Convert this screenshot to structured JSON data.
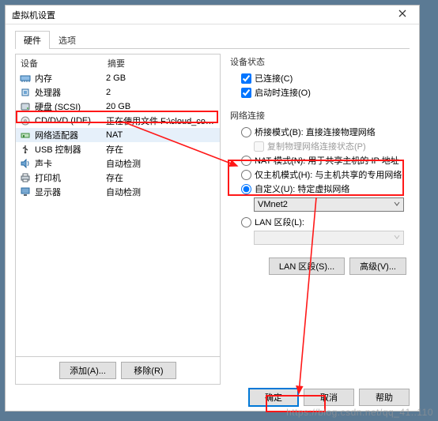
{
  "window": {
    "title": "虚拟机设置"
  },
  "tabs": {
    "hardware": "硬件",
    "options": "选项"
  },
  "columns": {
    "device": "设备",
    "summary": "摘要"
  },
  "devices": [
    {
      "icon": "memory-icon",
      "label": "内存",
      "summary": "2 GB"
    },
    {
      "icon": "cpu-icon",
      "label": "处理器",
      "summary": "2"
    },
    {
      "icon": "disk-icon",
      "label": "硬盘 (SCSI)",
      "summary": "20 GB"
    },
    {
      "icon": "cd-icon",
      "label": "CD/DVD (IDE)",
      "summary": "正在使用文件 F:\\cloud_comput..."
    },
    {
      "icon": "net-icon",
      "label": "网络适配器",
      "summary": "NAT"
    },
    {
      "icon": "usb-icon",
      "label": "USB 控制器",
      "summary": "存在"
    },
    {
      "icon": "sound-icon",
      "label": "声卡",
      "summary": "自动检测"
    },
    {
      "icon": "printer-icon",
      "label": "打印机",
      "summary": "存在"
    },
    {
      "icon": "display-icon",
      "label": "显示器",
      "summary": "自动检测"
    }
  ],
  "left_buttons": {
    "add": "添加(A)...",
    "remove": "移除(R)"
  },
  "right": {
    "status_title": "设备状态",
    "connected": "已连接(C)",
    "connect_at_poweron": "启动时连接(O)",
    "net_title": "网络连接",
    "bridged": "桥接模式(B): 直接连接物理网络",
    "replicate": "复制物理网络连接状态(P)",
    "nat": "NAT 模式(N): 用于共享主机的 IP 地址",
    "hostonly": "仅主机模式(H): 与主机共享的专用网络",
    "custom": "自定义(U): 特定虚拟网络",
    "custom_value": "VMnet2",
    "lanseg": "LAN 区段(L):",
    "lanseg_btn": "LAN 区段(S)...",
    "adv_btn": "高级(V)..."
  },
  "footer": {
    "ok": "确定",
    "cancel": "取消",
    "help": "帮助"
  },
  "watermark": "https://blog.csdn.net/qq_41..110"
}
